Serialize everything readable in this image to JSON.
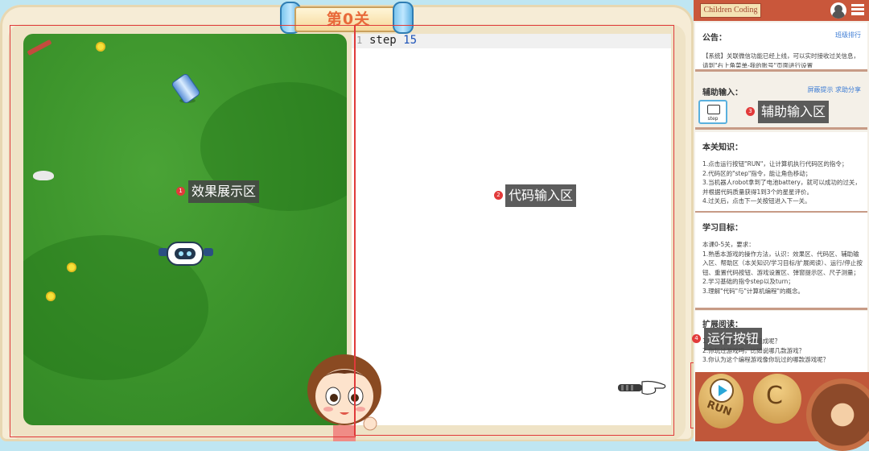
{
  "level": {
    "title": "第0关"
  },
  "areas": {
    "game_label": "效果展示区",
    "game_num": "1",
    "code_label": "代码输入区",
    "code_num": "2",
    "assist_label": "辅助输入区",
    "assist_num": "3",
    "run_label": "运行按钮",
    "run_num": "4"
  },
  "editor": {
    "line_number": "1",
    "keyword": "step",
    "argument": "15"
  },
  "header": {
    "brand": "Children Coding"
  },
  "notice": {
    "title": "公告：",
    "link": "班级排行",
    "text": "【系统】关联微信功能已经上线，可以实时接收过关信息，请到\"右上角菜单-我的账号\"页面进行设置"
  },
  "assist": {
    "title": "辅助输入：",
    "links": "屏蔽提示 求助分享",
    "step_button": "step"
  },
  "knowledge": {
    "title": "本关知识：",
    "lines": [
      "1.点击运行按钮\"RUN\"，让计算机执行代码区的指令；",
      "2.代码区的\"step\"指令，能让角色移动；",
      "3.当机器人robot拿到了电池battery，就可以成功的过关，并根据代码质量获得1到3个的星星评价。",
      "4.过关后，点击下一关按钮进入下一关。"
    ]
  },
  "goals": {
    "title": "学习目标：",
    "lines": [
      "本课0-5关，要求：",
      "1.熟悉本游戏的操作方法，认识：效果区、代码区、辅助输入区、帮助区（本关知识/学习目标/扩展阅读）、运行/停止按钮、重置代码按钮、游戏设置区、弹窗提示区、尺子测量；",
      "2.学习基础的指令step以及turn；",
      "3.理解\"代码\"与\"计算机编程\"的概念。"
    ]
  },
  "reading": {
    "title": "扩展阅读：",
    "lines": [
      "1.计算机由哪几部分组成呢？",
      "2.你玩过游戏吗，比如说哪几款游戏？",
      "3.你认为这个编程游戏像你玩过的哪款游戏呢？"
    ]
  },
  "controls": {
    "run": "RUN",
    "reset_symbol": "C"
  },
  "colors": {
    "accent_red": "#e03a3a",
    "panel_brown": "#c0573a",
    "link_blue": "#3b7bd4"
  }
}
